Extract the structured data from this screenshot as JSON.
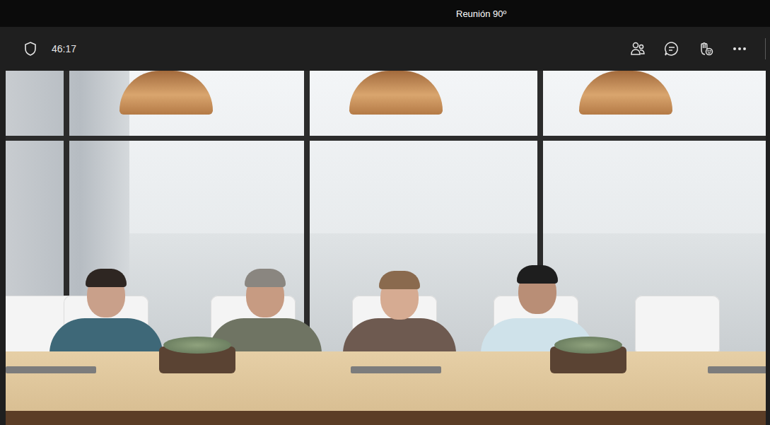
{
  "window": {
    "title": "Reunión 90º"
  },
  "toolbar": {
    "timer": "46:17"
  }
}
